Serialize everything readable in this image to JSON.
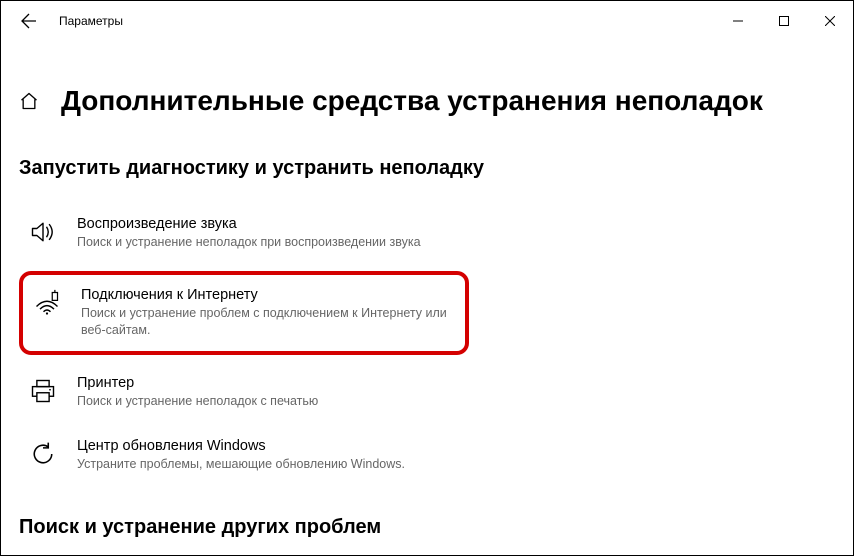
{
  "window": {
    "title": "Параметры"
  },
  "page": {
    "title": "Дополнительные средства устранения неполадок"
  },
  "section1": {
    "title": "Запустить диагностику и устранить неполадку"
  },
  "section2": {
    "title": "Поиск и устранение других проблем"
  },
  "items": {
    "audio": {
      "title": "Воспроизведение звука",
      "desc": "Поиск и устранение неполадок при воспроизведении звука"
    },
    "internet": {
      "title": "Подключения к Интернету",
      "desc": "Поиск и устранение проблем с подключением к Интернету или веб-сайтам."
    },
    "printer": {
      "title": "Принтер",
      "desc": "Поиск и устранение неполадок с печатью"
    },
    "update": {
      "title": "Центр обновления Windows",
      "desc": "Устраните проблемы, мешающие обновлению Windows."
    }
  }
}
